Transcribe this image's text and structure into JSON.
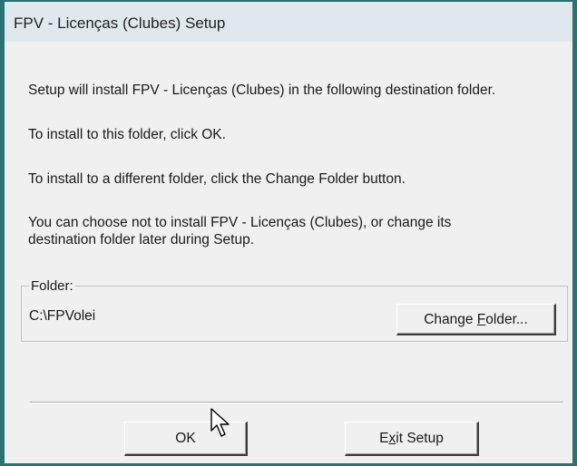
{
  "window": {
    "title": "FPV - Licenças (Clubes) Setup"
  },
  "messages": {
    "line1": "Setup will install FPV - Licenças (Clubes) in the following destination folder.",
    "line2": "To install to this folder, click OK.",
    "line3": "To install to a different folder, click the Change Folder button.",
    "line4a": "You can choose not to install FPV - Licenças (Clubes), or change its",
    "line4b": "destination folder later during Setup."
  },
  "folder": {
    "label": "Folder:",
    "path": "C:\\FPVolei",
    "change_button": {
      "prefix": "Change ",
      "mnemonic": "F",
      "suffix": "older..."
    }
  },
  "buttons": {
    "ok": "OK",
    "exit": {
      "prefix": "E",
      "mnemonic": "x",
      "suffix": "it Setup"
    }
  },
  "cursor": {
    "icon": "arrow-pointer-icon"
  }
}
